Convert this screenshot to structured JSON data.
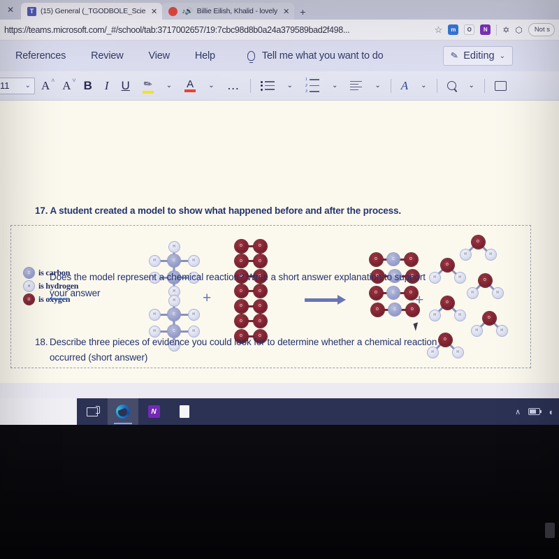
{
  "browser": {
    "tabs": [
      {
        "title": "(15) General (_TGODBOLE_Scien",
        "favicon": "teams-icon",
        "active": true
      },
      {
        "title": "Billie Eilish, Khalid - lovely",
        "favicon": "youtube-icon",
        "active": false
      }
    ],
    "new_tab_label": "+",
    "close_glyph": "✕",
    "url": "https://teams.microsoft.com/_#/school/tab:3717002657/19:7cbc98d8b0a24a379589bad2f498...",
    "star_glyph": "☆",
    "extensions": [
      {
        "name": "extension-icon-blue",
        "glyph": "m"
      },
      {
        "name": "extension-icon-office",
        "glyph": "O"
      },
      {
        "name": "extension-icon-onenote",
        "glyph": "N"
      }
    ],
    "collections_glyph": "✡",
    "favorites_glyph": "⬡",
    "profile_label": "Not s"
  },
  "ribbon": {
    "tabs": [
      {
        "label": "References"
      },
      {
        "label": "Review"
      },
      {
        "label": "View"
      },
      {
        "label": "Help"
      }
    ],
    "tell_me": "Tell me what you want to do",
    "editing_label": "Editing",
    "editing_chevron": "⌄"
  },
  "toolbar": {
    "font_size": "11",
    "font_size_chevron": "⌄",
    "grow_font": "A",
    "grow_font_mark": "˄",
    "shrink_font": "A",
    "shrink_font_mark": "˅",
    "bold": "B",
    "italic": "I",
    "underline": "U",
    "highlight_color": "#f2e21b",
    "font_color": "#ee3b2b",
    "more_label": "…",
    "chevron": "⌄",
    "styles_glyph": "A"
  },
  "document": {
    "q17_number": "17.",
    "q17_text": "A student created a model to show what happened before and after the process.",
    "legend": [
      {
        "atom": "carbon",
        "symbol": "C",
        "label": "is carbon"
      },
      {
        "atom": "hydrogen",
        "symbol": "H",
        "label": "is hydrogen"
      },
      {
        "atom": "oxygen",
        "symbol": "O",
        "label": "is oxygen"
      }
    ],
    "plus_sign": "+",
    "q17b_line1": "Does the model represent a chemical reaction? Write a short answer explanation to support",
    "q17b_line2a": "your",
    "q17b_line2b": " answer",
    "q18_number": "18.",
    "q18_line1": "Describe three pieces of evidence you could look for to determine whether a chemical reaction",
    "q18_line2": "occurred (short answer)"
  },
  "reaction_model": {
    "reactants": [
      {
        "formula": "C2H6",
        "name": "ethane",
        "count": 2
      },
      {
        "formula": "O2",
        "name": "oxygen",
        "count": 7
      }
    ],
    "products": [
      {
        "formula": "CO2",
        "name": "carbon dioxide",
        "count": 4
      },
      {
        "formula": "H2O",
        "name": "water",
        "count": 6
      }
    ]
  },
  "taskbar": {
    "items": [
      {
        "name": "task-view-icon",
        "label": "Task View",
        "active": false
      },
      {
        "name": "edge-icon",
        "label": "Microsoft Edge",
        "active": true
      },
      {
        "name": "onenote-icon",
        "label": "OneNote",
        "active": false,
        "glyph": "N"
      },
      {
        "name": "document-icon",
        "label": "Document",
        "active": false
      }
    ],
    "tray": {
      "chevron": "∧",
      "battery": "battery-icon",
      "wifi": "◖"
    }
  },
  "colors": {
    "carbon": "#9aa2cc",
    "hydrogen": "#d9dcee",
    "oxygen": "#7d2230",
    "accent_text": "#22306b",
    "taskbar": "#2b3254",
    "page": "#fbf9ee"
  }
}
